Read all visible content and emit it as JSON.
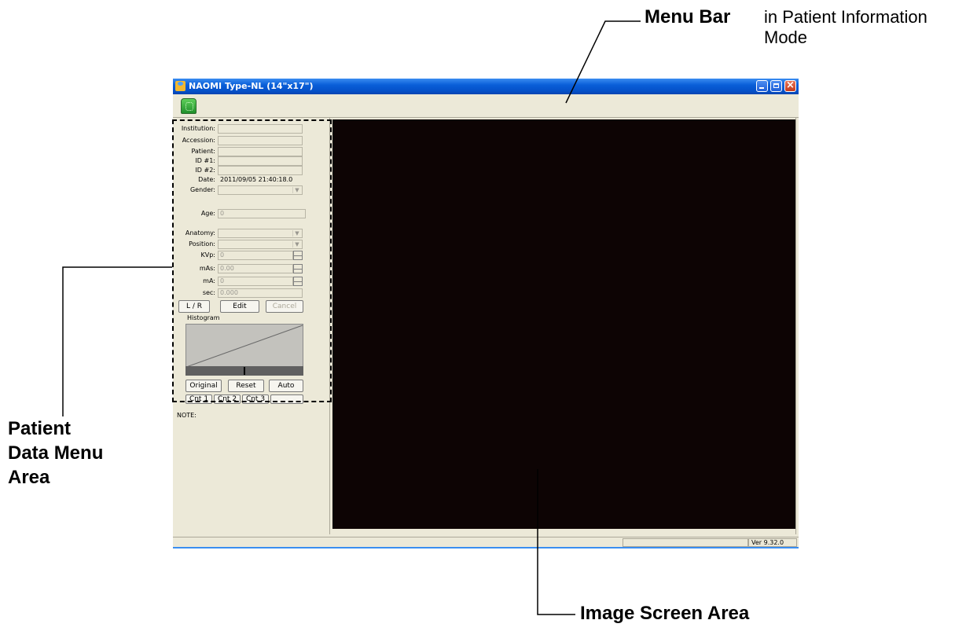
{
  "annotations": {
    "menu_bar_bold": "Menu Bar",
    "menu_bar_rest_1": "in Patient Information",
    "menu_bar_rest_2": "Mode",
    "patient_area_1": "Patient",
    "patient_area_2": "Data Menu",
    "patient_area_3": "Area",
    "image_screen": "Image Screen Area"
  },
  "window": {
    "title": "NAOMI  Type-NL (14\"x17\")",
    "controls": [
      "minimize-icon",
      "restore-icon",
      "close-icon"
    ],
    "close_glyph": "×"
  },
  "toolbar": {
    "button_icon": "naomi-green-icon"
  },
  "form": {
    "institution": {
      "label": "Institution:",
      "value": ""
    },
    "accession": {
      "label": "Accession:",
      "value": ""
    },
    "patient": {
      "label": "Patient:",
      "value": ""
    },
    "id1": {
      "label": "ID #1:",
      "value": ""
    },
    "id2": {
      "label": "ID #2:",
      "value": ""
    },
    "date": {
      "label": "Date:",
      "value": "2011/09/05 21:40:18.0"
    },
    "gender": {
      "label": "Gender:",
      "value": ""
    },
    "age": {
      "label": "Age:",
      "value": "0"
    },
    "anatomy": {
      "label": "Anatomy:",
      "value": ""
    },
    "position": {
      "label": "Position:",
      "value": ""
    },
    "kvp": {
      "label": "KVp:",
      "value": "0"
    },
    "mas": {
      "label": "mAs:",
      "value": "0.00"
    },
    "ma": {
      "label": "mA:",
      "value": "0"
    },
    "sec": {
      "label": "sec:",
      "value": "0.000"
    },
    "dropdown_arrow": "▼"
  },
  "buttons": {
    "lr": "L / R",
    "edit": "Edit",
    "cancel": "Cancel",
    "original": "Original",
    "reset": "Reset",
    "auto": "Auto",
    "cnt1": "Cnt 1",
    "cnt2": "Cnt 2",
    "cnt3": "Cnt 3"
  },
  "histogram": {
    "label": "Histogram"
  },
  "note": {
    "label": "NOTE:"
  },
  "status": {
    "version": "Ver 9.32.0"
  }
}
